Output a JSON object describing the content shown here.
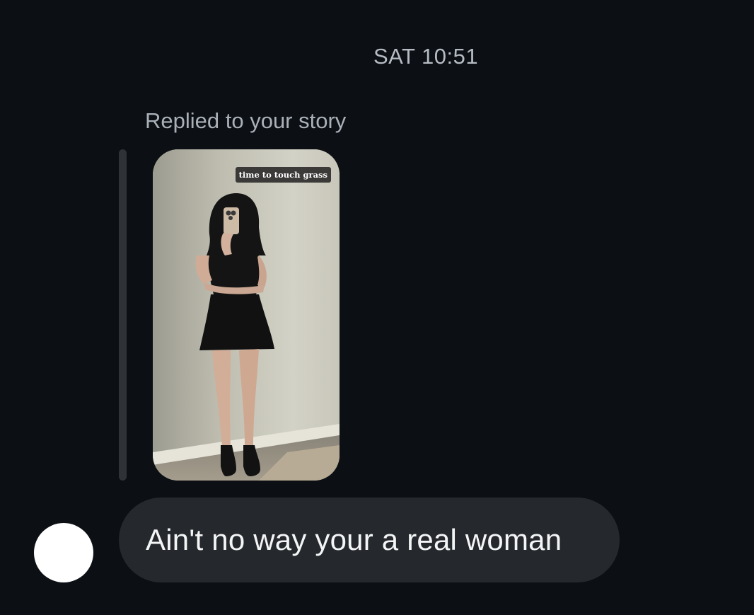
{
  "thread": {
    "timestamp": "SAT 10:51",
    "reply_context": "Replied to your story"
  },
  "story": {
    "caption_sticker": "time to touch grass",
    "background_color": "#c6c5b8",
    "image_description_icon": "story-photo"
  },
  "message": {
    "text": "Ain't no way your a real woman",
    "bubble_color": "#25282c"
  },
  "sender": {
    "avatar_color": "#ffffff"
  },
  "theme": {
    "background": "#0c0f13"
  }
}
